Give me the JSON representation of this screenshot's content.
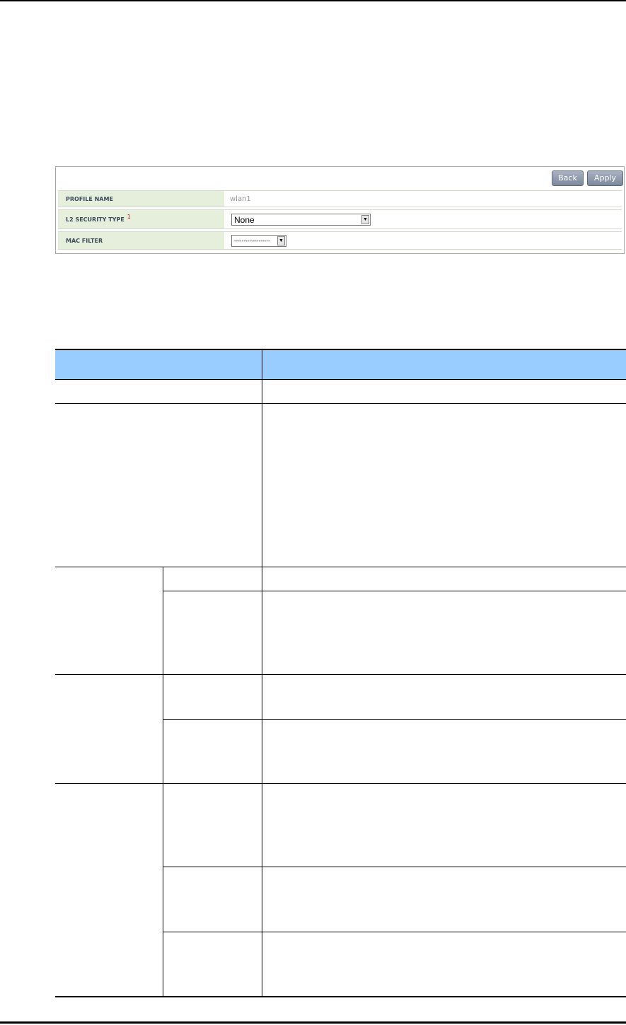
{
  "panel": {
    "buttons": {
      "back": "Back",
      "apply": "Apply"
    },
    "fields": [
      {
        "label": "PROFILE NAME",
        "value": "wlan1"
      },
      {
        "label": "L2 SECURITY TYPE",
        "superscript": "1",
        "value": "None"
      },
      {
        "label": "MAC FILTER",
        "value": "-------------------"
      }
    ]
  }
}
